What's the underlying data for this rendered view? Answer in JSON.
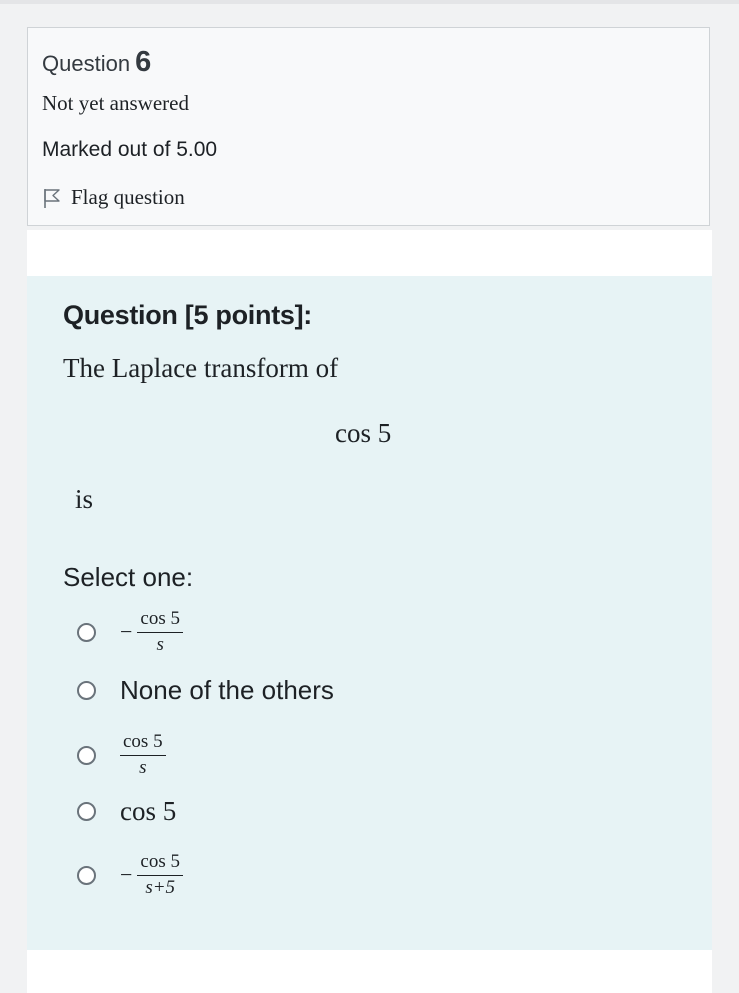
{
  "question_info": {
    "label": "Question",
    "number": "6",
    "state": "Not yet answered",
    "grade": "Marked out of 5.00",
    "flag_label": "Flag question"
  },
  "formulation": {
    "heading": "Question [5 points]:",
    "text": "The Laplace transform of",
    "math_display": "cos 5",
    "text_after": "is",
    "prompt": "Select one:"
  },
  "options": [
    {
      "sign": "−",
      "numerator": "cos 5",
      "denominator": "s"
    },
    {
      "text": "None of the others"
    },
    {
      "numerator": "cos 5",
      "denominator": "s"
    },
    {
      "math": "cos 5"
    },
    {
      "sign": "−",
      "numerator": "cos 5",
      "denominator": "s+5"
    }
  ],
  "icons": {
    "flag": "flag-outline-icon",
    "radio": "radio-unchecked-icon"
  },
  "colors": {
    "page_background": "#f1f2f3",
    "info_background": "#f8f9fa",
    "formulation_background": "#e7f3f5",
    "text": "#1d2125"
  }
}
